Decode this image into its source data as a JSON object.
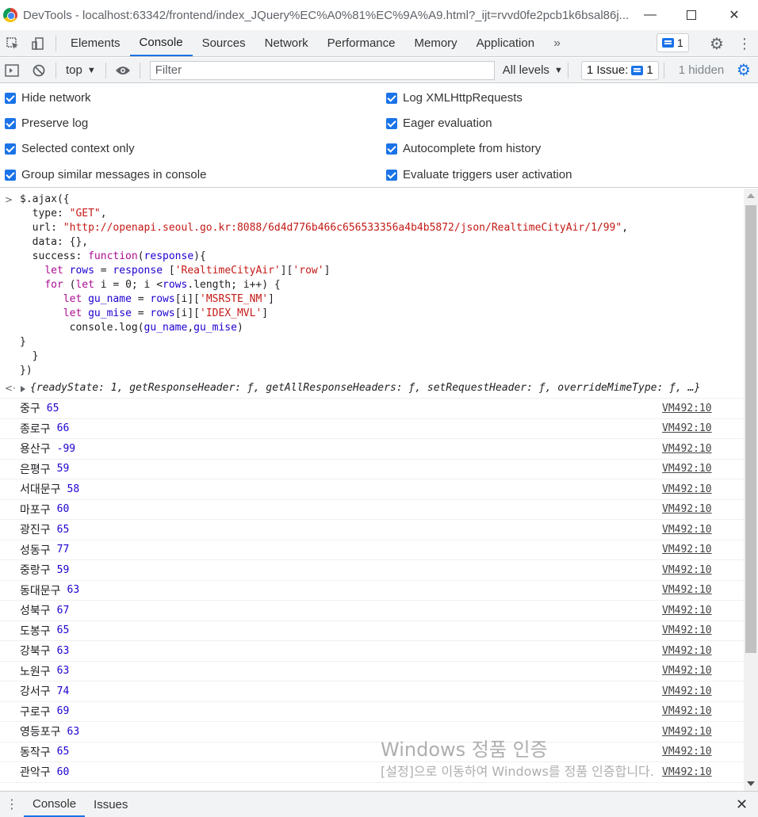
{
  "window": {
    "title": "DevTools - localhost:63342/frontend/index_JQuery%EC%A0%81%EC%9A%A9.html?_ijt=rvvd0fe2pcb1k6bsal86j..."
  },
  "tabs": [
    "Elements",
    "Console",
    "Sources",
    "Network",
    "Performance",
    "Memory",
    "Application"
  ],
  "tabs_more": "»",
  "issues_badge_count": "1",
  "toolbar": {
    "context": "top",
    "filter_placeholder": "Filter",
    "levels": "All levels",
    "issue_label": "1 Issue:",
    "issue_count": "1",
    "hidden": "1 hidden"
  },
  "settings": {
    "left": [
      "Hide network",
      "Preserve log",
      "Selected context only",
      "Group similar messages in console"
    ],
    "right": [
      "Log XMLHttpRequests",
      "Eager evaluation",
      "Autocomplete from history",
      "Evaluate triggers user activation"
    ]
  },
  "result_object": "{readyState: 1, getResponseHeader: ƒ, getAllResponseHeaders: ƒ, setRequestHeader: ƒ, overrideMimeType: ƒ, …}",
  "logs": [
    {
      "name": "중구",
      "value": "65",
      "source": "VM492:10"
    },
    {
      "name": "종로구",
      "value": "66",
      "source": "VM492:10"
    },
    {
      "name": "용산구",
      "value": "-99",
      "source": "VM492:10"
    },
    {
      "name": "은평구",
      "value": "59",
      "source": "VM492:10"
    },
    {
      "name": "서대문구",
      "value": "58",
      "source": "VM492:10"
    },
    {
      "name": "마포구",
      "value": "60",
      "source": "VM492:10"
    },
    {
      "name": "광진구",
      "value": "65",
      "source": "VM492:10"
    },
    {
      "name": "성동구",
      "value": "77",
      "source": "VM492:10"
    },
    {
      "name": "중랑구",
      "value": "59",
      "source": "VM492:10"
    },
    {
      "name": "동대문구",
      "value": "63",
      "source": "VM492:10"
    },
    {
      "name": "성북구",
      "value": "67",
      "source": "VM492:10"
    },
    {
      "name": "도봉구",
      "value": "65",
      "source": "VM492:10"
    },
    {
      "name": "강북구",
      "value": "63",
      "source": "VM492:10"
    },
    {
      "name": "노원구",
      "value": "63",
      "source": "VM492:10"
    },
    {
      "name": "강서구",
      "value": "74",
      "source": "VM492:10"
    },
    {
      "name": "구로구",
      "value": "69",
      "source": "VM492:10"
    },
    {
      "name": "영등포구",
      "value": "63",
      "source": "VM492:10"
    },
    {
      "name": "동작구",
      "value": "65",
      "source": "VM492:10"
    },
    {
      "name": "관악구",
      "value": "60",
      "source": "VM492:10"
    }
  ],
  "watermark": {
    "line1": "Windows 정품 인증",
    "line2": "[설정]으로 이동하여 Windows를 정품 인증합니다."
  },
  "drawer": {
    "tabs": [
      "Console",
      "Issues"
    ]
  }
}
